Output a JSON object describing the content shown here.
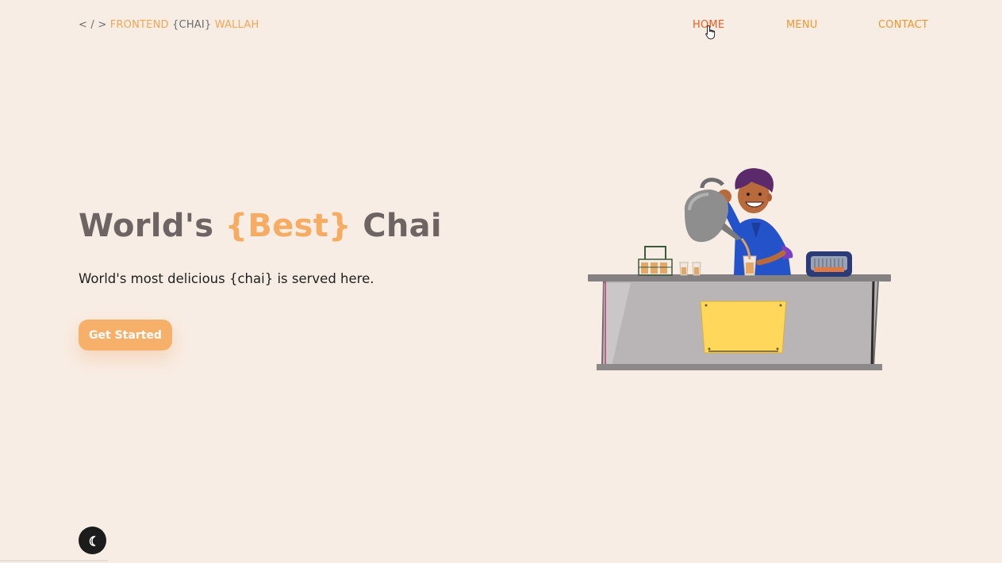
{
  "logo": {
    "code_mark": "< / > ",
    "word1": "FRONTEND",
    "word2": "{CHAI}",
    "word3": "WALLAH"
  },
  "nav": {
    "items": [
      {
        "label": "HOME",
        "active": true
      },
      {
        "label": "MENU",
        "active": false
      },
      {
        "label": "CONTACT",
        "active": false
      }
    ]
  },
  "hero": {
    "title_part1": "World's ",
    "title_accent": "{Best}",
    "title_part2": "Chai",
    "subtitle": "World's most delicious {chai} is served here.",
    "cta_label": "Get Started"
  },
  "icons": {
    "theme_toggle": "moon-icon",
    "cursor": "hand-pointer-icon"
  },
  "colors": {
    "background": "#f8ede4",
    "accent_orange": "#f6ad63",
    "nav_active": "#e85d1a",
    "nav_default": "#f0962e",
    "title_gray": "#6f6464",
    "toggle_bg": "#1c1c1c"
  }
}
